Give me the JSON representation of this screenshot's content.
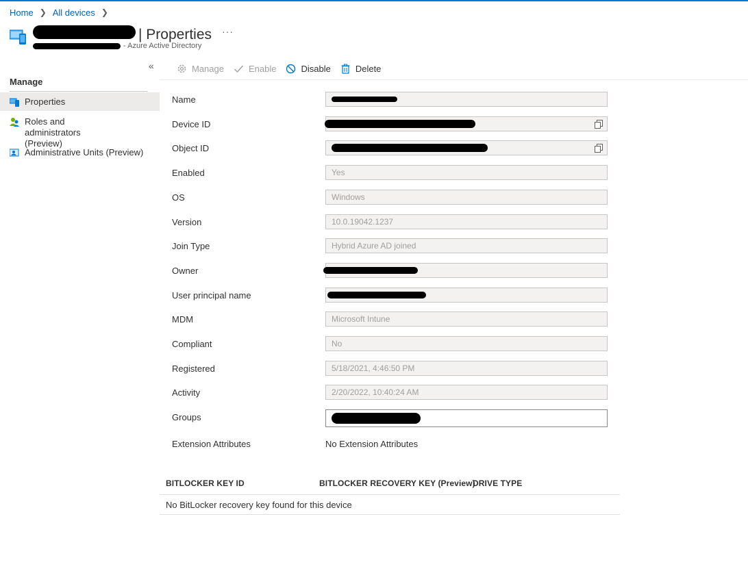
{
  "breadcrumb": {
    "home": "Home",
    "all_devices": "All devices"
  },
  "header": {
    "title": "| Properties",
    "subtitle_tail": "- Azure Active Directory",
    "more": "···"
  },
  "sidebar": {
    "collapse": "«",
    "section_title": "Manage",
    "items": [
      {
        "label": "Properties",
        "icon": "properties-icon"
      },
      {
        "label": "Roles and administrators (Preview)",
        "icon": "people-icon"
      },
      {
        "label": "Administrative Units (Preview)",
        "icon": "admin-units-icon"
      }
    ]
  },
  "toolbar": {
    "manage": "Manage",
    "enable": "Enable",
    "disable": "Disable",
    "delete": "Delete"
  },
  "fields": {
    "name": {
      "label": "Name"
    },
    "device_id": {
      "label": "Device ID"
    },
    "object_id": {
      "label": "Object ID"
    },
    "enabled": {
      "label": "Enabled",
      "value": "Yes"
    },
    "os": {
      "label": "OS",
      "value": "Windows"
    },
    "version": {
      "label": "Version",
      "value": "10.0.19042.1237"
    },
    "join_type": {
      "label": "Join Type",
      "value": "Hybrid Azure AD joined"
    },
    "owner": {
      "label": "Owner"
    },
    "upn": {
      "label": "User principal name"
    },
    "mdm": {
      "label": "MDM",
      "value": "Microsoft Intune"
    },
    "compliant": {
      "label": "Compliant",
      "value": "No"
    },
    "registered": {
      "label": "Registered",
      "value": "5/18/2021, 4:46:50 PM"
    },
    "activity": {
      "label": "Activity",
      "value": "2/20/2022, 10:40:24 AM"
    },
    "groups": {
      "label": "Groups"
    },
    "extension": {
      "label": "Extension Attributes",
      "value": "No Extension Attributes"
    }
  },
  "bitlocker": {
    "columns": [
      "BITLOCKER KEY ID",
      "BITLOCKER RECOVERY KEY (Preview)",
      "DRIVE TYPE"
    ],
    "empty_message": "No BitLocker recovery key found for this device"
  }
}
